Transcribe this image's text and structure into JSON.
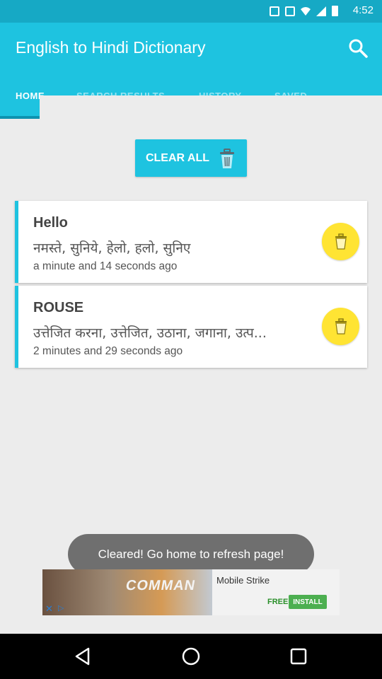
{
  "status_bar": {
    "time": "4:52"
  },
  "app_bar": {
    "title": "English to Hindi Dictionary",
    "tabs": [
      {
        "label": "HOME",
        "active": true
      },
      {
        "label": "SEARCH RESULTS",
        "active": false
      },
      {
        "label": "HISTORY",
        "active": false
      },
      {
        "label": "SAVED",
        "active": false
      }
    ]
  },
  "clear_all": {
    "label": "CLEAR ALL"
  },
  "history": [
    {
      "word": "Hello",
      "meaning": "नमस्ते, सुनिये, हेलो, हलो, सुनिए",
      "time_ago": "a minute and 14 seconds ago"
    },
    {
      "word": "ROUSE",
      "meaning": "उत्तेजित करना, उत्तेजित, उठाना, जगाना, उत्प...",
      "time_ago": "2 minutes and 29 seconds ago"
    }
  ],
  "toast": {
    "text": "Cleared! Go home to refresh page!"
  },
  "ad": {
    "banner_text": "COMMAN",
    "title": "Mobile Strike",
    "free_label": "FREE",
    "install_label": "INSTALL"
  },
  "colors": {
    "app_bar": "#1ec3e0",
    "status_bar": "#16a9c5",
    "delete_button": "#ffe433",
    "background": "#ececec"
  }
}
